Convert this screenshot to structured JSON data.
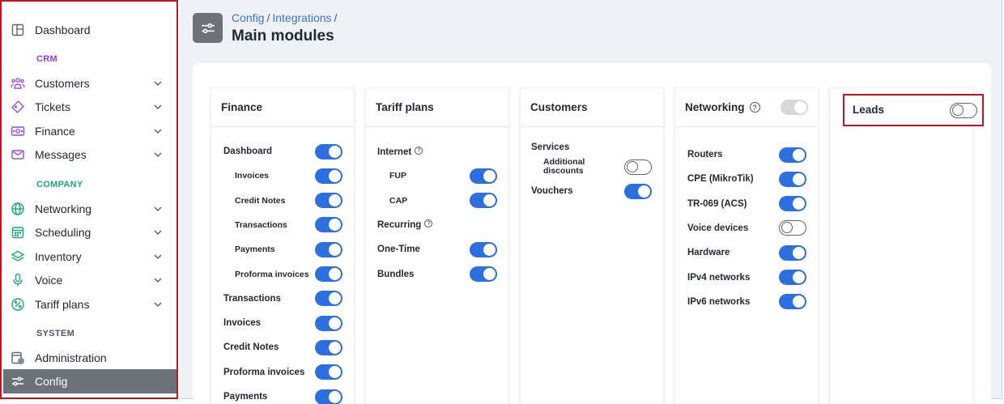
{
  "sidebar": {
    "items": [
      {
        "label": "Dashboard",
        "icon": "dashboard-icon",
        "chevron": false
      },
      {
        "label": "Customers",
        "icon": "customers-icon",
        "chevron": true
      },
      {
        "label": "Tickets",
        "icon": "ticket-icon",
        "chevron": true
      },
      {
        "label": "Finance",
        "icon": "finance-icon",
        "chevron": true
      },
      {
        "label": "Messages",
        "icon": "mail-icon",
        "chevron": true
      },
      {
        "label": "Networking",
        "icon": "globe-icon",
        "chevron": true
      },
      {
        "label": "Scheduling",
        "icon": "calendar-icon",
        "chevron": true
      },
      {
        "label": "Inventory",
        "icon": "layers-icon",
        "chevron": true
      },
      {
        "label": "Voice",
        "icon": "microphone-icon",
        "chevron": true
      },
      {
        "label": "Tariff plans",
        "icon": "percent-icon",
        "chevron": true
      },
      {
        "label": "Administration",
        "icon": "admin-icon",
        "chevron": false
      },
      {
        "label": "Config",
        "icon": "sliders-icon",
        "chevron": false,
        "active": true
      }
    ],
    "sections": {
      "crm": "CRM",
      "company": "COMPANY",
      "system": "SYSTEM"
    },
    "section_colors": {
      "crm": "#8b3fd8",
      "company": "#1aa876",
      "system": "#4b5563"
    },
    "icon_colors": {
      "purple": "#9b4de0",
      "green": "#1aa876",
      "gray": "#5b6676"
    }
  },
  "header": {
    "breadcrumb": [
      "Config",
      "Integrations"
    ],
    "title": "Main modules",
    "icon": "sliders-icon"
  },
  "colors": {
    "accent": "#2b6fe0",
    "disabled": "#d5d8dc",
    "highlight": "#c0151c"
  },
  "cards": {
    "finance": {
      "title": "Finance",
      "rows": [
        {
          "label": "Dashboard",
          "state": "on"
        },
        {
          "label": "Invoices",
          "state": "on"
        },
        {
          "label": "Credit Notes",
          "state": "on"
        },
        {
          "label": "Transactions",
          "state": "on"
        },
        {
          "label": "Payments",
          "state": "on"
        },
        {
          "label": "Proforma invoices",
          "state": "on"
        },
        {
          "label": "Transactions",
          "state": "on"
        },
        {
          "label": "Invoices",
          "state": "on"
        },
        {
          "label": "Credit Notes",
          "state": "on"
        },
        {
          "label": "Proforma invoices",
          "state": "on"
        },
        {
          "label": "Payments",
          "state": "on"
        }
      ]
    },
    "tariff": {
      "title": "Tariff plans",
      "rows": [
        {
          "label": "Internet",
          "state": "disabled",
          "help": true
        },
        {
          "label": "FUP",
          "state": "on"
        },
        {
          "label": "CAP",
          "state": "on"
        },
        {
          "label": "Recurring",
          "state": "disabled",
          "help": true
        },
        {
          "label": "One-Time",
          "state": "on"
        },
        {
          "label": "Bundles",
          "state": "on"
        }
      ]
    },
    "customers": {
      "title": "Customers",
      "services_label": "Services",
      "additional_label_1": "Additional",
      "additional_label_2": "discounts",
      "additional_state": "off",
      "vouchers_label": "Vouchers",
      "vouchers_state": "on"
    },
    "networking": {
      "title": "Networking",
      "header_state": "disabled",
      "rows": [
        {
          "label": "Routers",
          "state": "on"
        },
        {
          "label": "CPE (MikroTik)",
          "state": "on"
        },
        {
          "label": "TR-069 (ACS)",
          "state": "on"
        },
        {
          "label": "Voice devices",
          "state": "off"
        },
        {
          "label": "Hardware",
          "state": "on"
        },
        {
          "label": "IPv4 networks",
          "state": "on"
        },
        {
          "label": "IPv6 networks",
          "state": "on"
        }
      ]
    },
    "leads": {
      "title": "Leads",
      "state": "off"
    }
  }
}
